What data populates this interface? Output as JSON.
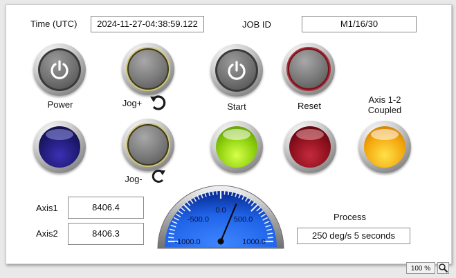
{
  "header": {
    "time_label": "Time (UTC)",
    "time_value": "2024-11-27-04:38:59.122",
    "job_label": "JOB ID",
    "job_value": "M1/16/30"
  },
  "buttons": {
    "power": "Power",
    "jog_plus": "Jog+",
    "jog_minus": "Jog-",
    "start": "Start",
    "reset": "Reset"
  },
  "indicators": {
    "coupled_line1": "Axis 1-2",
    "coupled_line2": "Coupled"
  },
  "axes": {
    "axis1_label": "Axis1",
    "axis1_value": "8406.4",
    "axis2_label": "Axis2",
    "axis2_value": "8406.3"
  },
  "gauge": {
    "tick_labels": [
      "-1000.0",
      "-500.0",
      "0.0",
      "500.0",
      "1000.0"
    ],
    "min": -1000,
    "max": 1000,
    "value": 250
  },
  "process": {
    "label": "Process",
    "value": "250 deg/s 5 seconds"
  },
  "status_bar": {
    "zoom": "100 %"
  },
  "colors": {
    "indicator_blue": "#1d1a6e",
    "indicator_green": "#8fd10e",
    "indicator_red": "#8a0f1c",
    "indicator_orange": "#f3a70c",
    "gauge_blue": "#1f63e8"
  }
}
